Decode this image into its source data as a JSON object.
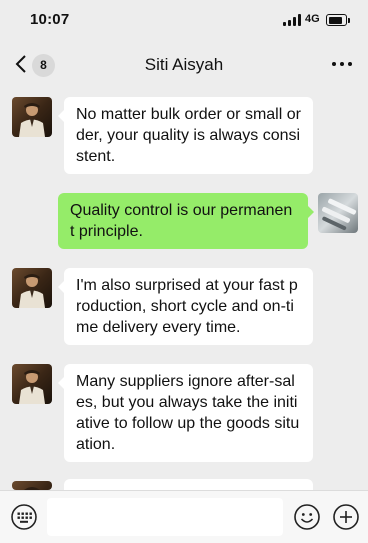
{
  "status_bar": {
    "time": "10:07",
    "network": "4G"
  },
  "nav": {
    "unread_count": "8",
    "title": "Siti Aisyah"
  },
  "messages": [
    {
      "sender": "contact",
      "text": "No matter bulk order or small order, your quality is always consistent."
    },
    {
      "sender": "me",
      "text": "Quality control is our permanent principle."
    },
    {
      "sender": "contact",
      "text": "I'm also surprised at your fast production, short cycle and on-time delivery every time."
    },
    {
      "sender": "contact",
      "text": "Many suppliers ignore after-sales, but you always take the initiative to follow up the goods situation."
    }
  ],
  "input": {
    "value": "",
    "placeholder": ""
  },
  "icons": [
    "back-icon",
    "more-icon",
    "voice-icon",
    "emoji-icon",
    "add-icon"
  ],
  "colors": {
    "background": "#ededed",
    "outgoing_bubble": "#95ec69",
    "incoming_bubble": "#ffffff"
  }
}
